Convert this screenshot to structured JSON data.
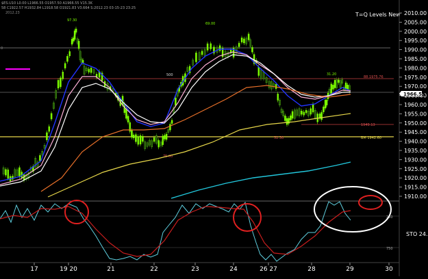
{
  "header": {
    "info_line_1": "$ES.U10 L0.00 L1966.55 O1957.50 A1966.55 V15.3K",
    "info_line_2": "58 C1922.57 H1932.84 L1918.58 O1921.83 V3.664 S:2012.23 03-15-23 23:25",
    "top_left_value": "2012.23"
  },
  "title": "T=Q Levels New",
  "price_axis": {
    "ticks": [
      "2010.00",
      "2005.00",
      "2000.00",
      "1995.00",
      "1990.00",
      "1985.00",
      "1980.00",
      "1975.00",
      "1970.00",
      "1965.00",
      "1960.00",
      "1955.00",
      "1950.00",
      "1945.00",
      "1940.00",
      "1935.00",
      "1930.00",
      "1925.00",
      "1920.00",
      "1915.00",
      "1910.00"
    ],
    "current_price": "1966.55"
  },
  "x_axis": {
    "labels": [
      "17",
      "19 20",
      "21",
      "22",
      "23",
      "24",
      "26 27",
      "28",
      "29",
      "30"
    ]
  },
  "annotations": {
    "peak_label_1": "97.30",
    "peak_label_2": "69.00",
    "peak_label_3": "31.20",
    "level_label_500": "500",
    "level_label_red_right": "88.1975.76",
    "level_label_low_1": "75.00",
    "level_label_low_2": "1949.13",
    "level_label_yellow": "BM 1942.60",
    "level_label_red_mid": "52.30",
    "left_label": "0"
  },
  "stochastic": {
    "label": "STO 24.",
    "level_high": "250",
    "level_low": "750"
  },
  "colors": {
    "background": "#000000",
    "candle_up": "#7CFC00",
    "blue_ma": "#2233ff",
    "white_ma": "#ffffff",
    "pink_ma": "#ffb0d8",
    "orange_ma": "#e8702a",
    "yellow_ma": "#e8d84a",
    "cyan_ma": "#22c8dd",
    "sto_fast": "#5fd0e0",
    "sto_slow": "#c81e1e",
    "circle_red": "#e02020",
    "circle_white": "#ffffff",
    "magenta_marker": "#ff00ff"
  }
}
